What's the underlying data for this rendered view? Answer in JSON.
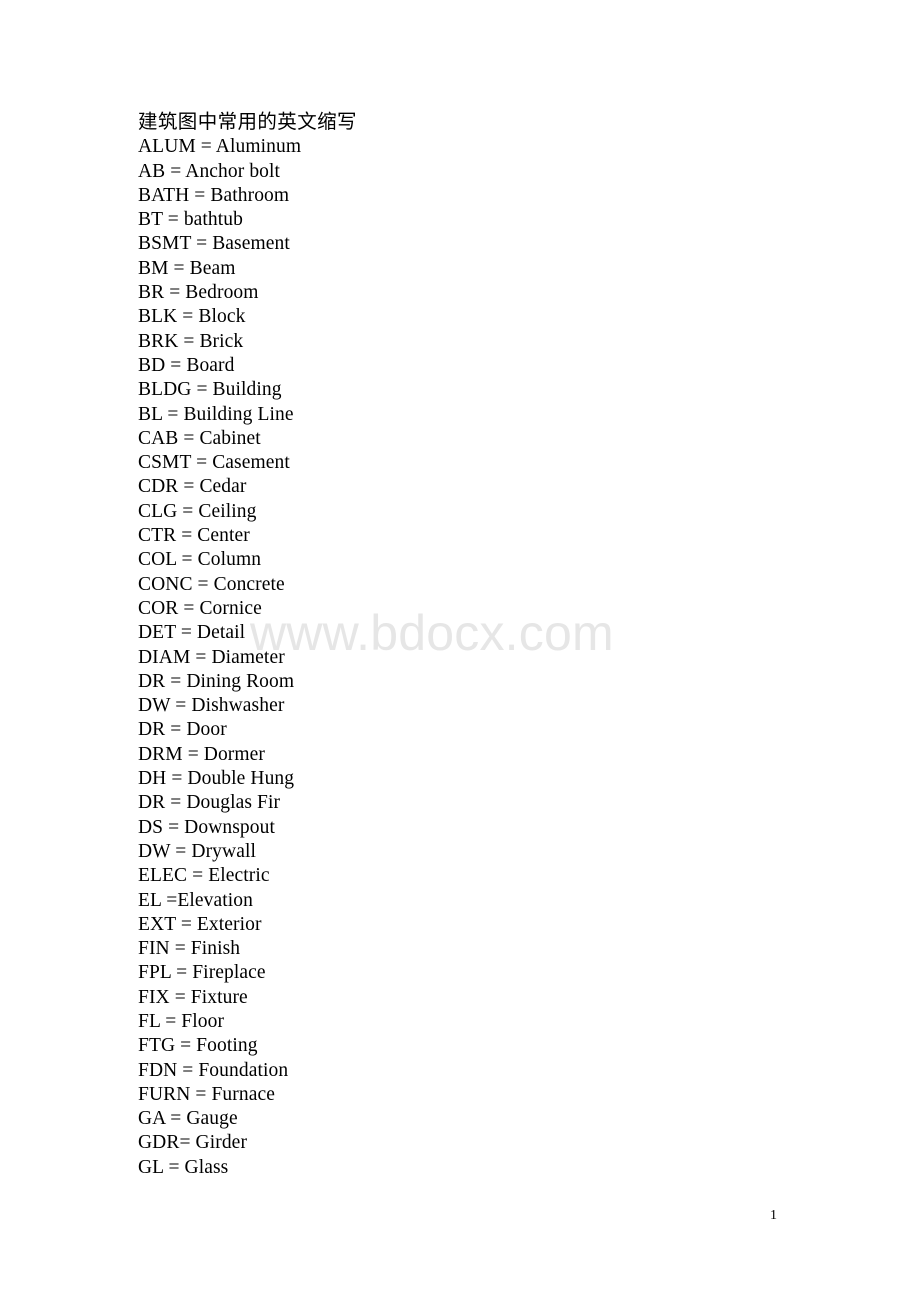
{
  "document": {
    "title": "建筑图中常用的英文缩写",
    "page_number": "1",
    "watermark": "www.bdocx.com",
    "entries": [
      "ALUM = Aluminum",
      "AB = Anchor bolt",
      "BATH = Bathroom",
      "BT = bathtub",
      "BSMT = Basement",
      "BM = Beam",
      "BR = Bedroom",
      "BLK = Block",
      "BRK = Brick",
      "BD = Board",
      "BLDG = Building",
      "BL = Building Line",
      "CAB = Cabinet",
      "CSMT = Casement",
      "CDR = Cedar",
      "CLG = Ceiling",
      "CTR = Center",
      "COL = Column",
      "CONC = Concrete",
      "COR = Cornice",
      "DET = Detail",
      "DIAM = Diameter",
      "DR = Dining Room",
      "DW = Dishwasher",
      "DR = Door",
      "DRM = Dormer",
      "DH = Double Hung",
      "DR = Douglas Fir",
      "DS = Downspout",
      "DW = Drywall",
      "ELEC = Electric",
      "EL =Elevation",
      "EXT = Exterior",
      "FIN = Finish",
      "FPL = Fireplace",
      "FIX = Fixture",
      "FL = Floor",
      "FTG = Footing",
      "FDN = Foundation",
      "FURN = Furnace",
      "GA = Gauge",
      "GDR= Girder",
      "GL = Glass"
    ]
  },
  "theme": {
    "page_background": "#ffffff",
    "text_color": "#000000",
    "watermark_color": "#e6e6e6"
  }
}
